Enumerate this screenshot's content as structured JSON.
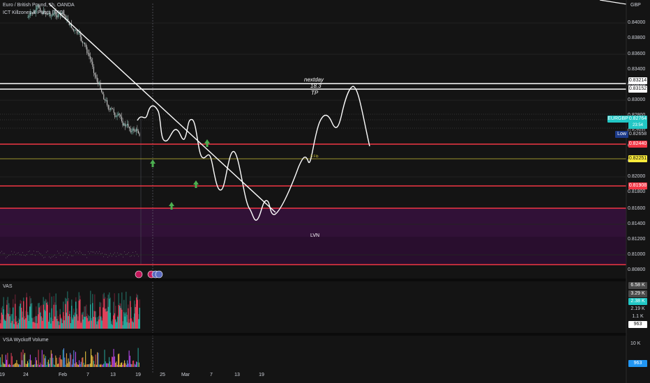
{
  "header": {
    "symbol_line": "Euro / British Pound, 1h, OANDA",
    "indicator": "ICT Killzones & Pivots [TFO]"
  },
  "currency": "GBP",
  "price_axis": [
    "0.84000",
    "0.83800",
    "0.83600",
    "0.83400",
    "0.83200",
    "0.83000",
    "0.82800",
    "0.82600",
    "0.82400",
    "0.82200",
    "0.82000",
    "0.81800",
    "0.81600",
    "0.81400",
    "0.81200",
    "0.81000",
    "0.80800"
  ],
  "tags": {
    "level_a": "0.83214",
    "level_b": "0.83152",
    "symbol": "EURGBP",
    "last_price": "0.82764",
    "countdown": "23:54",
    "low_label": "Low",
    "low_value": "0.82658",
    "red_1": "0.82440",
    "yellow": "0.82251",
    "red_2": "0.81908"
  },
  "annotations": {
    "tp_top": "nextday",
    "tp_mid": "18.3",
    "tp": "TP",
    "fib": ".5 Fib",
    "lvn": "LVN"
  },
  "vas": {
    "title": "VAS",
    "scale": [
      "6.58 K",
      "3.29 K",
      "2.38 K",
      "2.19 K",
      "1.1 K",
      "963"
    ]
  },
  "wyckoff": {
    "title": "VSA Wyckoff Volume",
    "scale": [
      "10 K",
      "963"
    ]
  },
  "time_axis": [
    "19",
    "24",
    "Feb",
    "7",
    "13",
    "19",
    "25",
    "Mar",
    "7",
    "13",
    "19"
  ],
  "colors": {
    "background": "#141414",
    "red_line": "#f23645",
    "yellow_line": "#fbeb3b",
    "lvn_zone": "#3a1240",
    "tag_cyan": "#22c7c5",
    "tag_blue": "#2962ff",
    "arrow_green": "#43a047"
  }
}
